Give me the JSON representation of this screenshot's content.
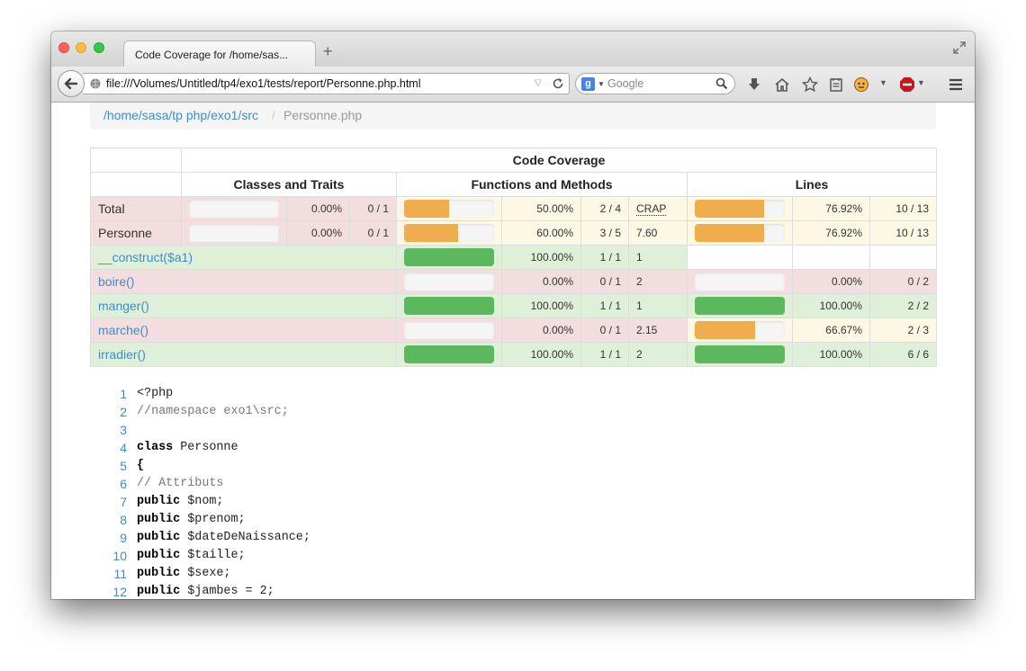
{
  "browser": {
    "tab_title": "Code Coverage for /home/sas...",
    "new_tab": "+",
    "url": "file:///Volumes/Untitled/tp4/exo1/tests/report/Personne.php.html",
    "search_placeholder": "Google",
    "search_engine_letter": "g"
  },
  "breadcrumb": {
    "path": "/home/sasa/tp php/exo1/src",
    "separator": "/",
    "current": "Personne.php"
  },
  "table": {
    "header_main": "Code Coverage",
    "header_classes": "Classes and Traits",
    "header_functions": "Functions and Methods",
    "header_lines": "Lines",
    "rows": [
      {
        "name": "Total",
        "style": "danger",
        "is_link": false,
        "classes": {
          "pct_value": 0.0,
          "pct": "0.00%",
          "count": "0 / 1"
        },
        "functions": {
          "pct_value": 50.0,
          "pct": "50.00%",
          "count": "2 / 4",
          "bar": "warning"
        },
        "crap": "CRAP",
        "crap_is_label": true,
        "lines": {
          "pct_value": 76.92,
          "pct": "76.92%",
          "count": "10 / 13",
          "bar": "warning"
        }
      },
      {
        "name": "Personne",
        "style": "danger",
        "is_link": false,
        "classes": {
          "pct_value": 0.0,
          "pct": "0.00%",
          "count": "0 / 1"
        },
        "functions": {
          "pct_value": 60.0,
          "pct": "60.00%",
          "count": "3 / 5",
          "bar": "warning"
        },
        "crap": "7.60",
        "crap_is_label": false,
        "lines": {
          "pct_value": 76.92,
          "pct": "76.92%",
          "count": "10 / 13",
          "bar": "warning"
        }
      },
      {
        "name": "__construct($a1)",
        "style": "success",
        "is_link": true,
        "functions": {
          "pct_value": 100.0,
          "pct": "100.00%",
          "count": "1 / 1",
          "bar": "success"
        },
        "crap": "1",
        "lines": null
      },
      {
        "name": "boire()",
        "style": "danger",
        "is_link": true,
        "functions": {
          "pct_value": 0.0,
          "pct": "0.00%",
          "count": "0 / 1",
          "bar": "danger"
        },
        "crap": "2",
        "lines": {
          "pct_value": 0.0,
          "pct": "0.00%",
          "count": "0 / 2",
          "bar": "danger"
        }
      },
      {
        "name": "manger()",
        "style": "success",
        "is_link": true,
        "functions": {
          "pct_value": 100.0,
          "pct": "100.00%",
          "count": "1 / 1",
          "bar": "success"
        },
        "crap": "1",
        "lines": {
          "pct_value": 100.0,
          "pct": "100.00%",
          "count": "2 / 2",
          "bar": "success"
        }
      },
      {
        "name": "marche()",
        "style": "danger",
        "is_link": true,
        "functions": {
          "pct_value": 0.0,
          "pct": "0.00%",
          "count": "0 / 1",
          "bar": "danger"
        },
        "crap": "2.15",
        "lines": {
          "pct_value": 66.67,
          "pct": "66.67%",
          "count": "2 / 3",
          "bar": "warning"
        }
      },
      {
        "name": "irradier()",
        "style": "success",
        "is_link": true,
        "functions": {
          "pct_value": 100.0,
          "pct": "100.00%",
          "count": "1 / 1",
          "bar": "success"
        },
        "crap": "2",
        "lines": {
          "pct_value": 100.0,
          "pct": "100.00%",
          "count": "6 / 6",
          "bar": "success"
        }
      }
    ]
  },
  "code": [
    {
      "n": "1",
      "parts": [
        {
          "t": "<?php",
          "c": ""
        }
      ]
    },
    {
      "n": "2",
      "parts": [
        {
          "t": "//namespace exo1\\src;",
          "c": "cm"
        }
      ]
    },
    {
      "n": "3",
      "parts": []
    },
    {
      "n": "4",
      "parts": [
        {
          "t": "class",
          "c": "kw"
        },
        {
          "t": " Personne",
          "c": ""
        }
      ]
    },
    {
      "n": "5",
      "parts": [
        {
          "t": "{",
          "c": "kw"
        }
      ]
    },
    {
      "n": "6",
      "parts": [
        {
          "t": "// Attributs",
          "c": "cm"
        }
      ]
    },
    {
      "n": "7",
      "parts": [
        {
          "t": "public",
          "c": "kw"
        },
        {
          "t": " $nom;",
          "c": ""
        }
      ]
    },
    {
      "n": "8",
      "parts": [
        {
          "t": "public",
          "c": "kw"
        },
        {
          "t": " $prenom;",
          "c": ""
        }
      ]
    },
    {
      "n": "9",
      "parts": [
        {
          "t": "public",
          "c": "kw"
        },
        {
          "t": " $dateDeNaissance;",
          "c": ""
        }
      ]
    },
    {
      "n": "10",
      "parts": [
        {
          "t": "public",
          "c": "kw"
        },
        {
          "t": " $taille;",
          "c": ""
        }
      ]
    },
    {
      "n": "11",
      "parts": [
        {
          "t": "public",
          "c": "kw"
        },
        {
          "t": " $sexe;",
          "c": ""
        }
      ]
    },
    {
      "n": "12",
      "parts": [
        {
          "t": "public",
          "c": "kw"
        },
        {
          "t": " $jambes = 2;",
          "c": ""
        }
      ]
    }
  ]
}
